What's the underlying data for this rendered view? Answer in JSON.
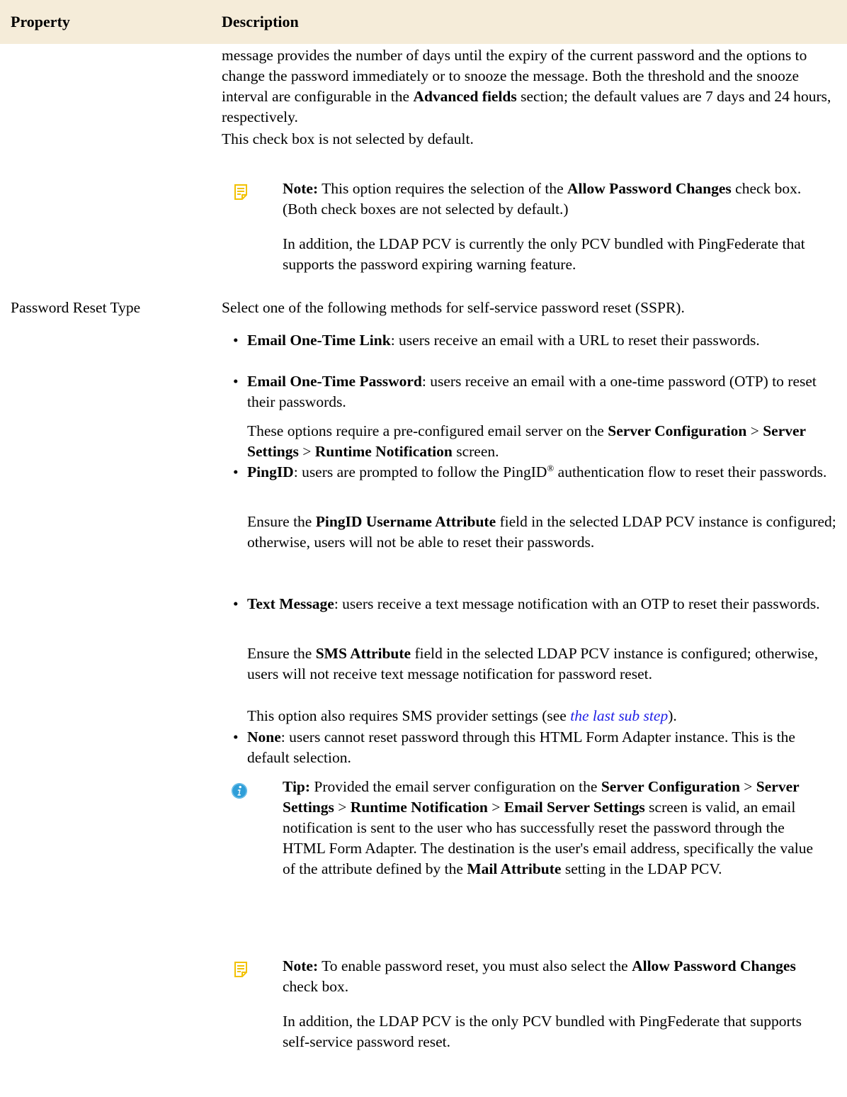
{
  "table": {
    "header": {
      "property": "Property",
      "description": "Description"
    }
  },
  "row1": {
    "cont_p1": [
      {
        "t": "message provides the number of days until the expiry of the current password and the options to change the password immediately or to snooze the message. Both the threshold and the snooze interval are configurable in the "
      },
      {
        "t": "Advanced fields",
        "b": true
      },
      {
        "t": " section; the default values are 7 days and 24 hours, respectively."
      }
    ],
    "cont_p2": "This check box is not selected by default.",
    "note1": [
      {
        "t": "Note:",
        "b": true
      },
      {
        "t": "  This option requires the selection of the "
      },
      {
        "t": "Allow Password Changes",
        "b": true
      },
      {
        "t": " check box. (Both check boxes are not selected by default.)"
      }
    ],
    "note1_p2": "In addition, the LDAP PCV is currently the only PCV bundled with PingFederate that supports the password expiring warning feature."
  },
  "row2": {
    "property": "Password Reset Type",
    "intro": "Select one of the following methods for self-service password reset (SSPR).",
    "bullet_char": "•",
    "b1": [
      {
        "t": "Email One-Time Link",
        "b": true
      },
      {
        "t": ": users receive an email with a URL to reset their passwords."
      }
    ],
    "b2": [
      {
        "t": "Email One-Time Password",
        "b": true
      },
      {
        "t": ": users receive an email with a one-time password (OTP) to reset their passwords."
      }
    ],
    "b2_p": [
      {
        "t": "These options require a pre-configured email server on the "
      },
      {
        "t": "Server Configuration",
        "b": true
      },
      {
        "t": " > "
      },
      {
        "t": "Server Settings",
        "b": true
      },
      {
        "t": " > "
      },
      {
        "t": "Runtime Notification",
        "b": true
      },
      {
        "t": " screen."
      }
    ],
    "b3": [
      {
        "t": "PingID",
        "b": true
      },
      {
        "t": ": users are prompted to follow the PingID"
      },
      {
        "t": "®",
        "sup": true
      },
      {
        "t": " authentication flow to reset their passwords."
      }
    ],
    "b3_p": [
      {
        "t": "Ensure the "
      },
      {
        "t": "PingID Username Attribute",
        "b": true
      },
      {
        "t": " field in the selected LDAP PCV instance is configured; otherwise, users will not be able to reset their passwords."
      }
    ],
    "b4": [
      {
        "t": "Text Message",
        "b": true
      },
      {
        "t": ": users receive a text message notification with an OTP to reset their passwords."
      }
    ],
    "b4_p": [
      {
        "t": "Ensure the "
      },
      {
        "t": "SMS Attribute",
        "b": true
      },
      {
        "t": " field in the selected LDAP PCV instance is configured; otherwise, users will not receive text message notification for password reset."
      }
    ],
    "b4_p2": [
      {
        "t": "This option also requires SMS provider settings (see "
      },
      {
        "t": "the last sub step",
        "link": true
      },
      {
        "t": ")."
      }
    ],
    "b5": [
      {
        "t": "None",
        "b": true
      },
      {
        "t": ": users cannot reset password through this HTML Form Adapter instance. This is the default selection."
      }
    ],
    "tip": [
      {
        "t": "Tip:",
        "b": true
      },
      {
        "t": "  Provided the email server configuration on the "
      },
      {
        "t": "Server Configuration",
        "b": true
      },
      {
        "t": " > "
      },
      {
        "t": "Server Settings",
        "b": true
      },
      {
        "t": " > "
      },
      {
        "t": "Runtime Notification",
        "b": true
      },
      {
        "t": " > "
      },
      {
        "t": "Email Server Settings",
        "b": true
      },
      {
        "t": " screen is valid, an email notification is sent to the user who has successfully reset the password through the HTML Form Adapter. The destination is the user's email address, specifically the value of the attribute defined by the "
      },
      {
        "t": "Mail Attribute",
        "b": true
      },
      {
        "t": " setting in the LDAP PCV."
      }
    ],
    "note2": [
      {
        "t": "Note:",
        "b": true
      },
      {
        "t": "  To enable password reset, you must also select the "
      },
      {
        "t": "Allow Password Changes",
        "b": true
      },
      {
        "t": " check box."
      }
    ],
    "note2_p2": "In addition, the LDAP PCV is the only PCV bundled with PingFederate that supports self-service password reset."
  },
  "icons": {
    "note": "note-icon",
    "tip": "info-icon"
  },
  "colors": {
    "header_bg": "#f5ecd9",
    "note_icon": "#f2c100",
    "tip_icon": "#2f9ed8",
    "link": "#1e1ee6"
  }
}
